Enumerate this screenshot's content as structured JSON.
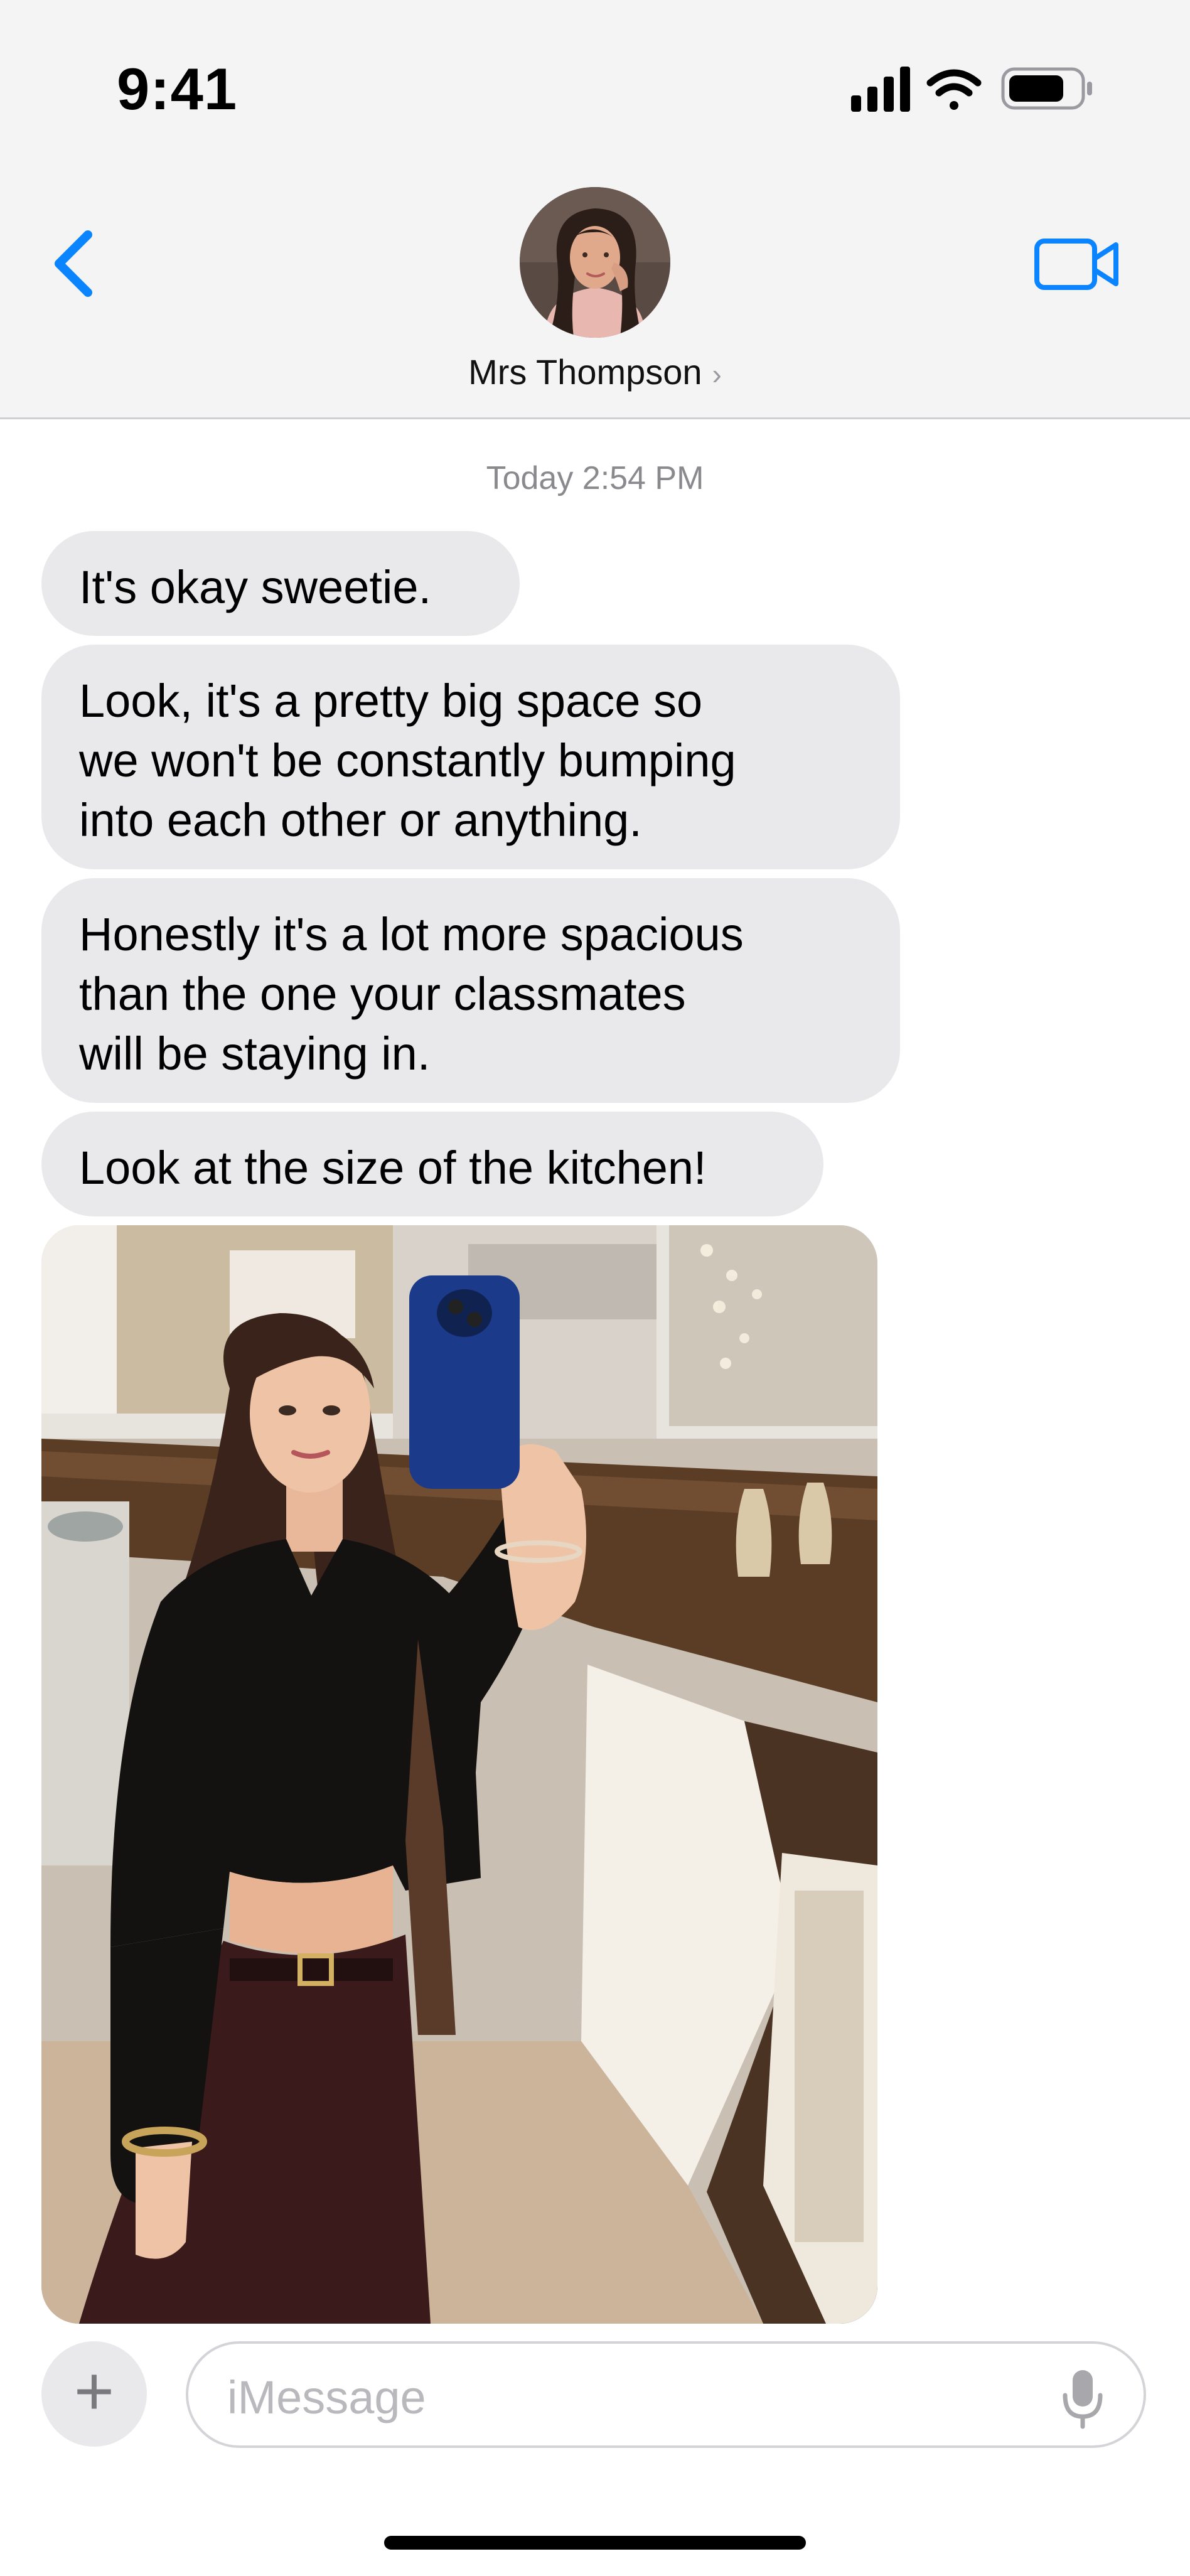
{
  "status_bar": {
    "time": "9:41",
    "icons": [
      "cellular-signal-icon",
      "wifi-icon",
      "battery-icon"
    ]
  },
  "header": {
    "contact_name": "Mrs Thompson",
    "chevron": "›",
    "back_icon": "chevron-left-icon",
    "video_icon": "video-camera-icon"
  },
  "conversation": {
    "timestamp": "Today 2:54 PM",
    "messages": [
      {
        "text": "It's okay sweetie."
      },
      {
        "text": "Look, it's a pretty big space so\nwe won't be constantly bumping\ninto each other or anything."
      },
      {
        "text": "Honestly it's a lot more spacious\nthan the one your classmates\nwill be staying in."
      },
      {
        "text": "Look at the size of the kitchen!"
      }
    ]
  },
  "input_bar": {
    "plus_label": "+",
    "placeholder": "iMessage",
    "value": ""
  },
  "colors": {
    "accent": "#0a84ff",
    "bubble_incoming": "#e9e9eb",
    "header_bg": "#f4f4f5"
  }
}
